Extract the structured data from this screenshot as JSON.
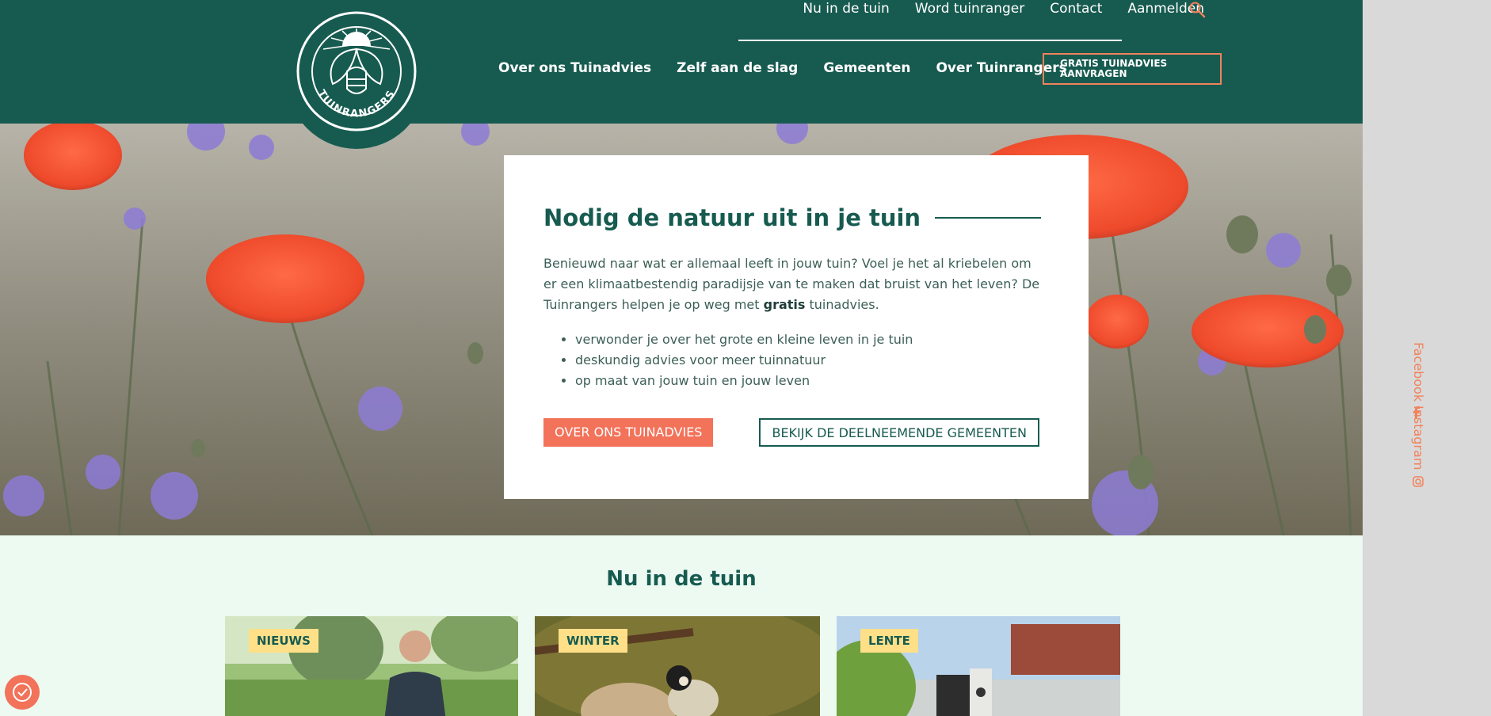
{
  "header": {
    "logo_text": "TUINRANGERS",
    "top_nav": [
      "Nu in de tuin",
      "Word tuinranger",
      "Contact",
      "Aanmelden"
    ],
    "main_nav": [
      "Over ons Tuinadvies",
      "Zelf aan de slag",
      "Gemeenten",
      "Over Tuinrangers"
    ],
    "cta_label": "GRATIS TUINADVIES AANVRAGEN"
  },
  "hero": {
    "title": "Nodig de natuur uit in je tuin",
    "text_before_bold": "Benieuwd naar wat er allemaal leeft in jouw tuin? Voel je het al kriebelen om er een klimaatbestendig paradijsje van te maken dat bruist van het leven? De Tuinrangers helpen je op weg met ",
    "text_bold": "gratis",
    "text_after_bold": " tuinadvies.",
    "bullets": [
      "verwonder je over het grote en kleine leven in je tuin",
      "deskundig advies voor meer tuinnatuur",
      "op maat van jouw tuin en jouw leven"
    ],
    "primary_button": "OVER ONS TUINADVIES",
    "secondary_button": "BEKIJK DE DEELNEEMENDE GEMEENTEN"
  },
  "social": {
    "facebook": "Facebook",
    "instagram": "Instagram"
  },
  "news": {
    "title": "Nu in de tuin",
    "cards": [
      {
        "tag": "NIEUWS",
        "image": "man-in-garden-photo"
      },
      {
        "tag": "WINTER",
        "image": "bird-feeder-photo"
      },
      {
        "tag": "LENTE",
        "image": "garden-birdhouse-photo"
      }
    ]
  },
  "colors": {
    "brand_green": "#175b50",
    "accent_orange": "#f2725a",
    "tag_yellow": "#ffe089",
    "section_bg": "#ecfaf2"
  }
}
